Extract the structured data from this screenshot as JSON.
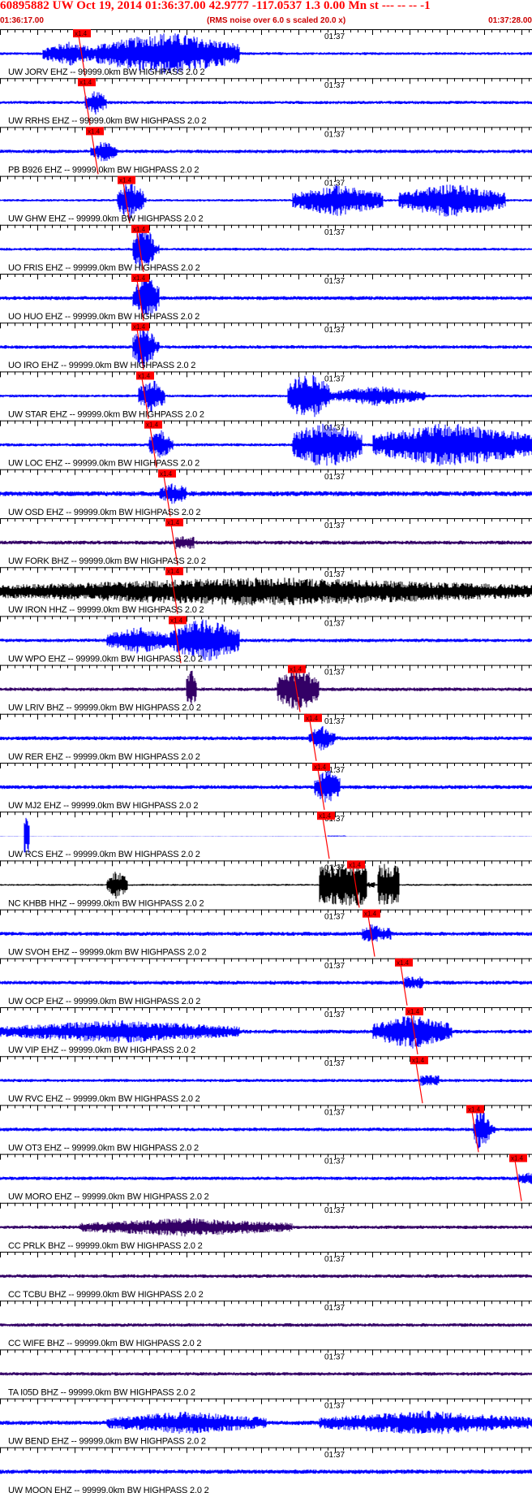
{
  "header": {
    "title": "60895882 UW Oct 19, 2014 01:36:37.00   42.9777 -117.0537  1.3 0.00 Mn st --- -- --  -1",
    "start_time": "01:36:17.00",
    "note": "(RMS noise over 6.0 s scaled 20.0 x)",
    "end_time": "01:37:28.00"
  },
  "colors": {
    "header_red": "#ff0000",
    "pick_red": "#ff0000",
    "trace_blue": "#0000ff",
    "trace_black": "#000000",
    "trace_purple": "#330066",
    "grid": "#000000"
  },
  "chart_data": {
    "type": "line",
    "title": "60895882 UW Oct 19, 2014 01:36:37.00   42.9777 -117.0537  1.3 0.00 Mn st --- -- --  -1",
    "x_range": [
      "01:36:17.00",
      "01:37:28.00"
    ],
    "time_label": "01:37",
    "pick_label": "x1.4",
    "traces": [
      {
        "label": "UW JORV EHZ -- 99999.0km BW  HIGHPASS  2.0  2",
        "color": "#0000ff",
        "pick": 0.155,
        "amp": 0.4,
        "bursts": [
          [
            0.08,
            0.18,
            1.7
          ],
          [
            0.18,
            0.45,
            3.0
          ]
        ]
      },
      {
        "label": "UW RRHS EHZ -- 99999.0km BW  HIGHPASS  2.0  2",
        "color": "#0000ff",
        "pick": 0.165,
        "amp": 0.45,
        "bursts": [
          [
            0.16,
            0.2,
            1.8
          ]
        ]
      },
      {
        "label": "PB B926 EHZ -- 99999.0km BW  HIGHPASS  2.0  2",
        "color": "#0000ff",
        "pick": 0.18,
        "amp": 0.5,
        "bursts": [
          [
            0.17,
            0.22,
            1.5
          ]
        ]
      },
      {
        "label": "UW GHW EHZ -- 99999.0km BW  HIGHPASS  2.0  2",
        "color": "#0000ff",
        "pick": 0.24,
        "amp": 0.35,
        "bursts": [
          [
            0.22,
            0.27,
            2.8
          ],
          [
            0.55,
            0.72,
            2.2
          ],
          [
            0.75,
            0.95,
            2.4
          ]
        ]
      },
      {
        "label": "UO FRIS EHZ -- 99999.0km BW  HIGHPASS  2.0  2",
        "color": "#0000ff",
        "pick": 0.265,
        "amp": 0.4,
        "bursts": [
          [
            0.25,
            0.29,
            3.5
          ]
        ]
      },
      {
        "label": "UO HUO EHZ -- 99999.0km BW  HIGHPASS  2.0  2",
        "color": "#0000ff",
        "pick": 0.265,
        "amp": 0.55,
        "bursts": [
          [
            0.25,
            0.3,
            3.2
          ]
        ]
      },
      {
        "label": "UO IRO EHZ -- 99999.0km BW  HIGHPASS  2.0  2",
        "color": "#0000ff",
        "pick": 0.265,
        "amp": 0.5,
        "bursts": [
          [
            0.25,
            0.29,
            3.2
          ]
        ]
      },
      {
        "label": "UW STAR EHZ -- 99999.0km BW  HIGHPASS  2.0  2",
        "color": "#0000ff",
        "pick": 0.275,
        "amp": 0.4,
        "bursts": [
          [
            0.26,
            0.31,
            2.4
          ],
          [
            0.54,
            0.62,
            3.6
          ],
          [
            0.62,
            0.8,
            1.4
          ]
        ]
      },
      {
        "label": "UW LOC EHZ -- 99999.0km BW  HIGHPASS  2.0  2",
        "color": "#0000ff",
        "pick": 0.29,
        "amp": 0.45,
        "bursts": [
          [
            0.28,
            0.32,
            2.2
          ],
          [
            0.55,
            0.68,
            3.6
          ],
          [
            0.7,
            1.0,
            3.2
          ]
        ]
      },
      {
        "label": "UW OSD EHZ -- 99999.0km BW  HIGHPASS  2.0  2",
        "color": "#0000ff",
        "pick": 0.315,
        "amp": 0.7,
        "bursts": [
          [
            0.3,
            0.35,
            1.5
          ]
        ]
      },
      {
        "label": "UW FORK BHZ -- 99999.0km BW  HIGHPASS  2.0  2",
        "color": "#330066",
        "pick": 0.33,
        "amp": 0.55,
        "bursts": []
      },
      {
        "label": "UW IRON HHZ -- 99999.0km BW  HIGHPASS  2.0  2",
        "color": "#000000",
        "pick": 0.33,
        "amp": 0.3,
        "bursts": [
          [
            0.0,
            1.0,
            2.0
          ]
        ]
      },
      {
        "label": "UW WPO EHZ -- 99999.0km BW  HIGHPASS  2.0  2",
        "color": "#0000ff",
        "pick": 0.335,
        "amp": 0.5,
        "bursts": [
          [
            0.2,
            0.32,
            1.9
          ],
          [
            0.32,
            0.45,
            3.2
          ]
        ]
      },
      {
        "label": "UW LRIV BHZ -- 99999.0km BW  HIGHPASS  2.0  2",
        "color": "#330066",
        "pick": 0.56,
        "amp": 0.5,
        "bursts": [
          [
            0.35,
            0.37,
            3.0
          ],
          [
            0.52,
            0.6,
            3.4
          ]
        ]
      },
      {
        "label": "UW RER EHZ -- 99999.0km BW  HIGHPASS  2.0  2",
        "color": "#0000ff",
        "pick": 0.59,
        "amp": 0.55,
        "bursts": [
          [
            0.58,
            0.63,
            1.8
          ]
        ]
      },
      {
        "label": "UW MJ2 EHZ -- 99999.0km BW  HIGHPASS  2.0  2",
        "color": "#0000ff",
        "pick": 0.605,
        "amp": 0.55,
        "bursts": [
          [
            0.59,
            0.64,
            2.6
          ]
        ]
      },
      {
        "label": "UW RCS EHZ -- 99999.0km BW  HIGHPASS  2.0  2",
        "color": "#0000ff",
        "pick": 0.615,
        "amp": 0.05,
        "bursts": [
          [
            0.045,
            0.055,
            12.0
          ]
        ]
      },
      {
        "label": "NC KHBB HHZ -- 99999.0km BW  HIGHPASS  2.0  2",
        "color": "#000000",
        "pick": 0.67,
        "amp": 0.25,
        "bursts": [
          [
            0.2,
            0.24,
            2.0
          ],
          [
            0.6,
            0.69,
            5.4
          ],
          [
            0.71,
            0.75,
            5.6
          ]
        ]
      },
      {
        "label": "UW SVOH EHZ -- 99999.0km BW  HIGHPASS  2.0  2",
        "color": "#0000ff",
        "pick": 0.7,
        "amp": 0.55,
        "bursts": [
          [
            0.68,
            0.72,
            1.6
          ]
        ]
      },
      {
        "label": "UW OCP EHZ -- 99999.0km BW  HIGHPASS  2.0  2",
        "color": "#0000ff",
        "pick": 0.76,
        "amp": 0.55,
        "bursts": []
      },
      {
        "label": "UW VIP EHZ -- 99999.0km BW  HIGHPASS  2.0  2",
        "color": "#0000ff",
        "pick": 0.78,
        "amp": 0.55,
        "bursts": [
          [
            0.0,
            0.45,
            1.6
          ],
          [
            0.7,
            0.85,
            2.4
          ]
        ]
      },
      {
        "label": "UW RVC EHZ -- 99999.0km BW  HIGHPASS  2.0  2",
        "color": "#0000ff",
        "pick": 0.79,
        "amp": 0.45,
        "bursts": []
      },
      {
        "label": "UW OT3 EHZ -- 99999.0km BW  HIGHPASS  2.0  2",
        "color": "#0000ff",
        "pick": 0.895,
        "amp": 0.5,
        "bursts": [
          [
            0.89,
            0.92,
            3.4
          ]
        ]
      },
      {
        "label": "UW MORO EHZ -- 99999.0km BW  HIGHPASS  2.0  2",
        "color": "#0000ff",
        "pick": 0.975,
        "amp": 0.5,
        "bursts": []
      },
      {
        "label": "CC PRLK BHZ -- 99999.0km BW  HIGHPASS  2.0  2",
        "color": "#330066",
        "pick": null,
        "amp": 0.5,
        "bursts": [
          [
            0.15,
            0.55,
            1.3
          ]
        ]
      },
      {
        "label": "CC TCBU BHZ -- 99999.0km BW  HIGHPASS  2.0  2",
        "color": "#330066",
        "pick": null,
        "amp": 0.5,
        "bursts": []
      },
      {
        "label": "CC WIFE BHZ -- 99999.0km BW  HIGHPASS  2.0  2",
        "color": "#330066",
        "pick": null,
        "amp": 0.5,
        "bursts": []
      },
      {
        "label": "TA I05D BHZ -- 99999.0km BW  HIGHPASS  2.0  2",
        "color": "#330066",
        "pick": null,
        "amp": 0.5,
        "bursts": []
      },
      {
        "label": "UW BEND EHZ -- 99999.0km BW  HIGHPASS  2.0  2",
        "color": "#0000ff",
        "pick": null,
        "amp": 0.6,
        "bursts": [
          [
            0.2,
            0.5,
            1.6
          ],
          [
            0.6,
            1.0,
            1.7
          ]
        ]
      },
      {
        "label": "UW MOON EHZ -- 99999.0km BW  HIGHPASS  2.0  2",
        "color": "#0000ff",
        "pick": null,
        "amp": 0.6,
        "bursts": []
      }
    ]
  }
}
